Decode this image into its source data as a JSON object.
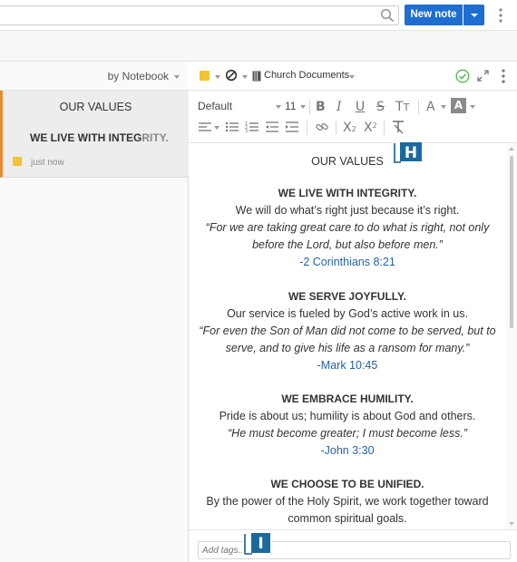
{
  "topbar": {
    "search_placeholder": "",
    "new_note_label": "New note"
  },
  "note_list": {
    "sort_label": "by Notebook",
    "notes": [
      {
        "title": "OUR VALUES",
        "snippet_strong": "WE LIVE WITH INTEG",
        "snippet_fade": "RITY.",
        "time": "just now"
      }
    ]
  },
  "editor_header": {
    "notebook_name": "Church Documents"
  },
  "format_toolbar": {
    "font": "Default",
    "size": "11"
  },
  "document": {
    "title": "OUR VALUES",
    "sections": [
      {
        "heading": "WE LIVE WITH INTEGRITY.",
        "statement": "We will do what’s right just because it’s right.",
        "quote_lines": [
          "“For we are taking great care to do what is right, not only",
          "before the Lord, but also before men.”"
        ],
        "reference": "-2 Corinthians 8:21"
      },
      {
        "heading": "WE SERVE JOYFULLY.",
        "statement": "Our service is fueled by God’s active work in us.",
        "quote_lines": [
          "“For even the Son of Man did not come to be served, but to",
          "serve, and to give his life as a ransom for many.”"
        ],
        "reference": "-Mark 10:45"
      },
      {
        "heading": "WE EMBRACE HUMILITY.",
        "statement": "Pride is about us; humility is about God and others.",
        "quote_lines": [
          "“He must become greater; I must become less.”"
        ],
        "reference": "-John 3:30"
      },
      {
        "heading": "WE CHOOSE TO BE UNIFIED.",
        "statement_lines": [
          "By the power of the Holy Spirit, we work together toward",
          "common spiritual goals."
        ]
      }
    ]
  },
  "badges": {
    "top": "H",
    "bottom": "I"
  },
  "tagbar": {
    "placeholder": "Add tags..."
  },
  "colors": {
    "accent": "#1f6dd1",
    "selection_border": "#e88b2e",
    "sticky": "#f4c430",
    "reference_link": "#2563a8",
    "sync_check": "#5cb85c"
  }
}
